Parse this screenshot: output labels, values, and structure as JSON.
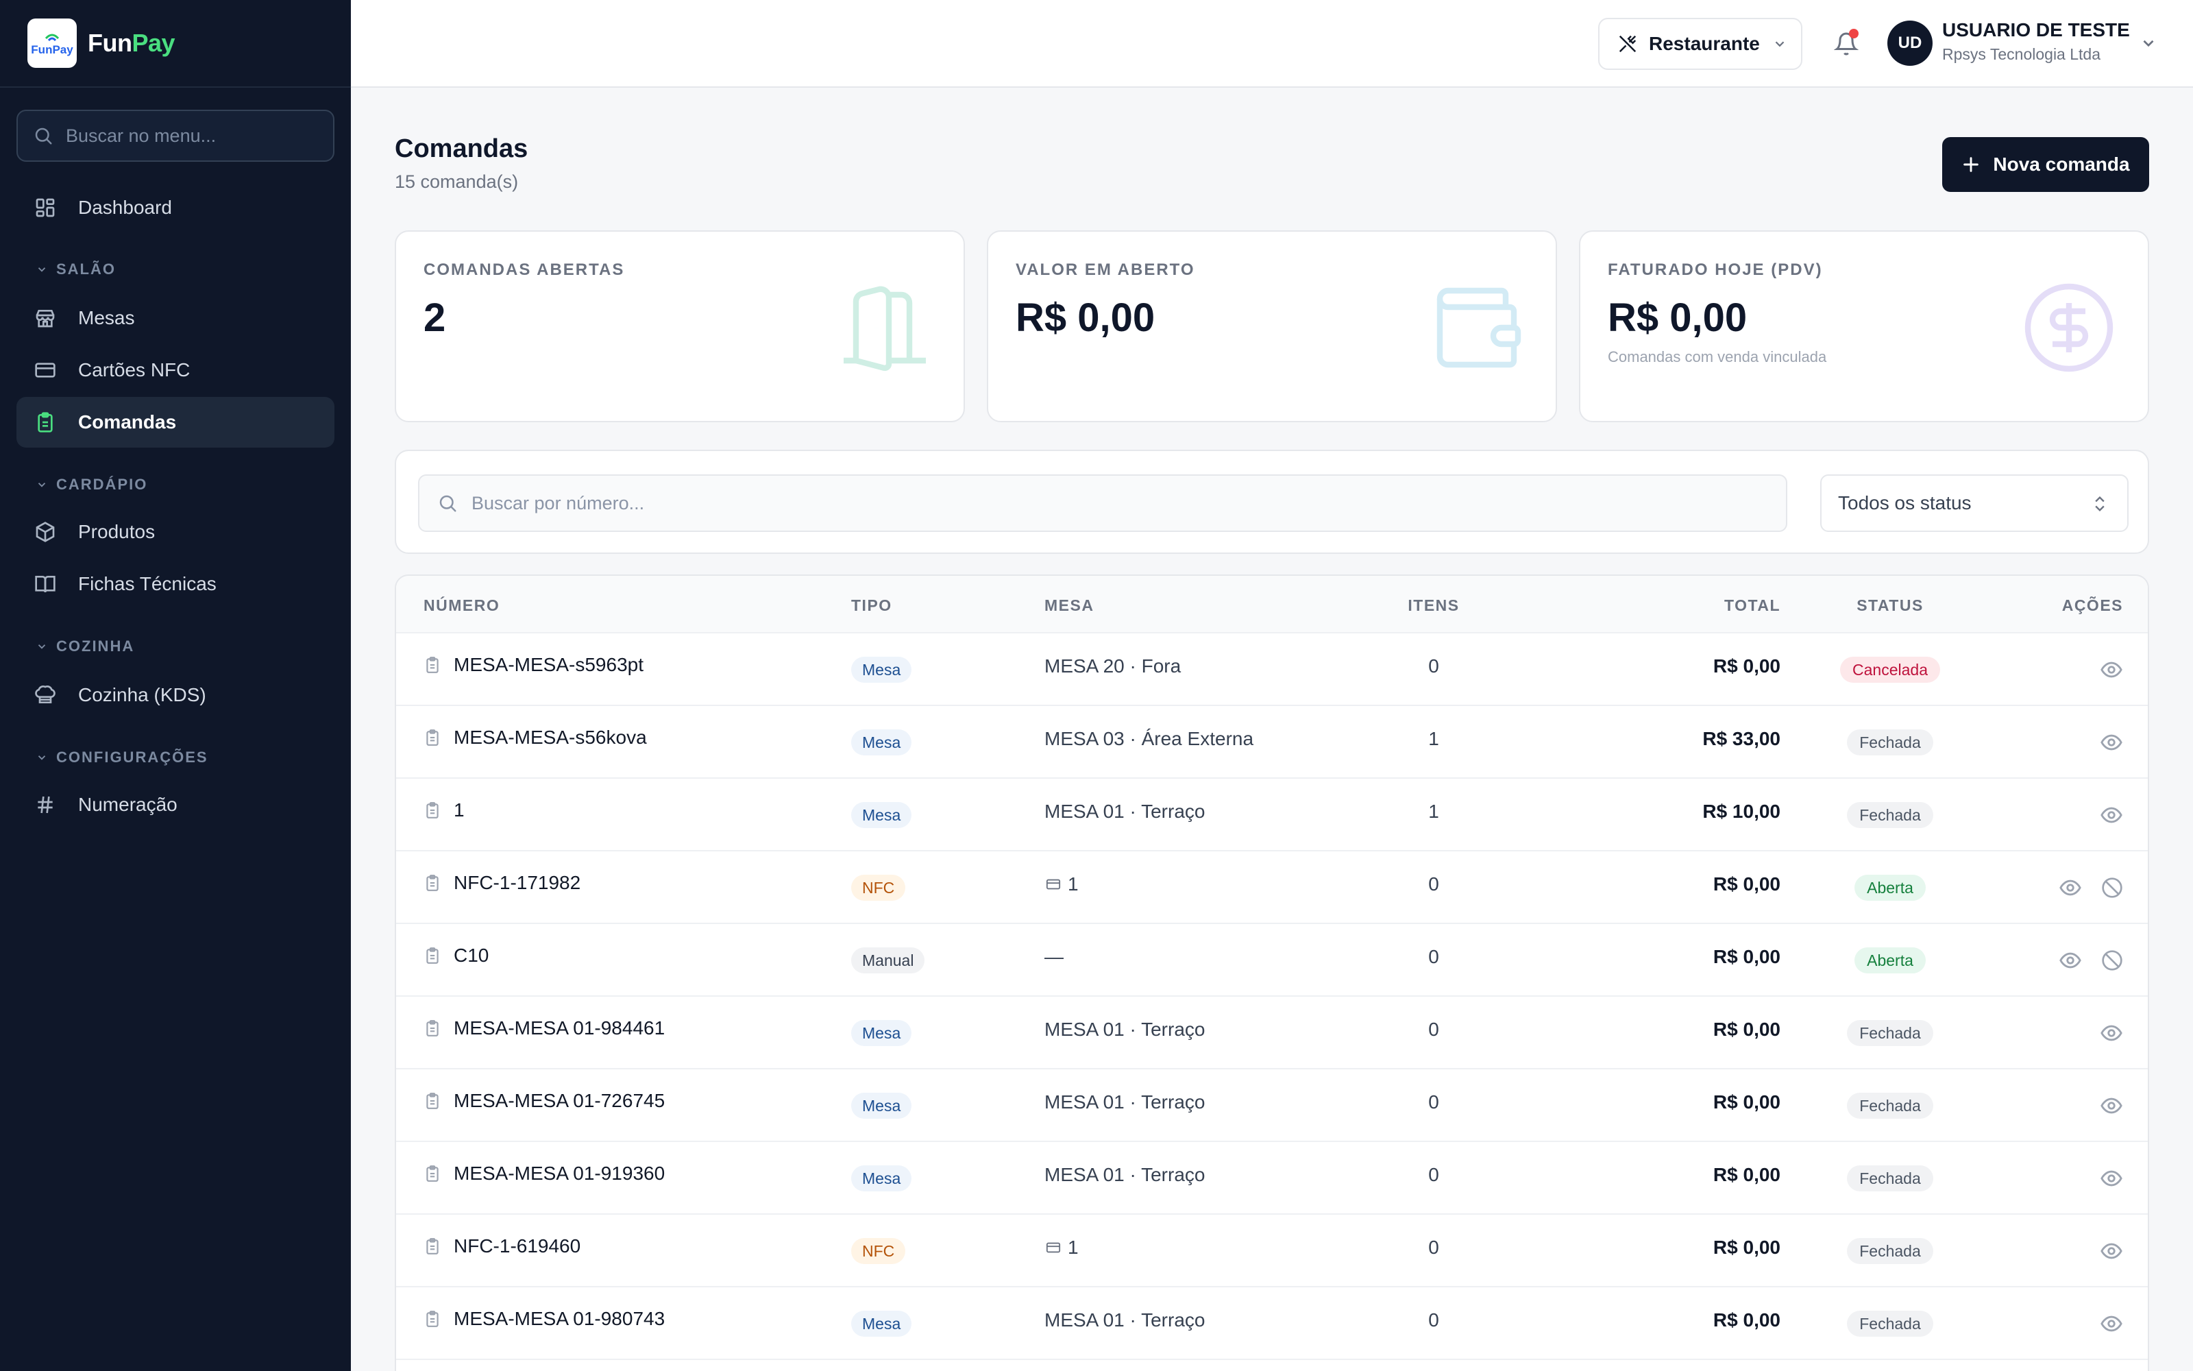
{
  "brand": {
    "logo_text": "FunPay",
    "name_part1": "Fun",
    "name_part2": "Pay"
  },
  "sidebar": {
    "search_placeholder": "Buscar no menu...",
    "dashboard": "Dashboard",
    "sections": {
      "salao": "SALÃO",
      "cardapio": "CARDÁPIO",
      "cozinha": "COZINHA",
      "configuracoes": "CONFIGURAÇÕES"
    },
    "items": {
      "mesas": "Mesas",
      "cartoes": "Cartões NFC",
      "comandas": "Comandas",
      "produtos": "Produtos",
      "fichas": "Fichas Técnicas",
      "kds": "Cozinha (KDS)",
      "numeracao": "Numeração"
    },
    "active": "Comandas"
  },
  "topbar": {
    "restaurant": "Restaurante",
    "avatar_initials": "UD",
    "user_name": "USUARIO DE TESTE",
    "user_company": "Rpsys Tecnologia Ltda",
    "has_notification": true
  },
  "page": {
    "title": "Comandas",
    "subtitle": "15 comanda(s)",
    "new_button": "Nova comanda"
  },
  "stats": {
    "abertas": {
      "label": "COMANDAS ABERTAS",
      "value": "2"
    },
    "valor": {
      "label": "VALOR EM ABERTO",
      "value": "R$ 0,00"
    },
    "faturado": {
      "label": "FATURADO HOJE (PDV)",
      "value": "R$ 0,00",
      "sub": "Comandas com venda vinculada"
    }
  },
  "filters": {
    "search_placeholder": "Buscar por número...",
    "status_selected": "Todos os status"
  },
  "table": {
    "headers": {
      "numero": "NÚMERO",
      "tipo": "TIPO",
      "mesa": "MESA",
      "itens": "ITENS",
      "total": "TOTAL",
      "status": "STATUS",
      "acoes": "AÇÕES"
    },
    "rows": [
      {
        "numero": "MESA-MESA-s5963pt",
        "tipo": "Mesa",
        "mesa": "MESA 20 · Fora",
        "itens": "0",
        "total": "R$ 0,00",
        "status": "Cancelada"
      },
      {
        "numero": "MESA-MESA-s56kova",
        "tipo": "Mesa",
        "mesa": "MESA 03 · Área Externa",
        "itens": "1",
        "total": "R$ 33,00",
        "status": "Fechada"
      },
      {
        "numero": "1",
        "tipo": "Mesa",
        "mesa": "MESA 01 · Terraço",
        "itens": "1",
        "total": "R$ 10,00",
        "status": "Fechada"
      },
      {
        "numero": "NFC-1-171982",
        "tipo": "NFC",
        "mesa": "1",
        "itens": "0",
        "total": "R$ 0,00",
        "status": "Aberta"
      },
      {
        "numero": "C10",
        "tipo": "Manual",
        "mesa": "—",
        "itens": "0",
        "total": "R$ 0,00",
        "status": "Aberta"
      },
      {
        "numero": "MESA-MESA 01-984461",
        "tipo": "Mesa",
        "mesa": "MESA 01 · Terraço",
        "itens": "0",
        "total": "R$ 0,00",
        "status": "Fechada"
      },
      {
        "numero": "MESA-MESA 01-726745",
        "tipo": "Mesa",
        "mesa": "MESA 01 · Terraço",
        "itens": "0",
        "total": "R$ 0,00",
        "status": "Fechada"
      },
      {
        "numero": "MESA-MESA 01-919360",
        "tipo": "Mesa",
        "mesa": "MESA 01 · Terraço",
        "itens": "0",
        "total": "R$ 0,00",
        "status": "Fechada"
      },
      {
        "numero": "NFC-1-619460",
        "tipo": "NFC",
        "mesa": "1",
        "itens": "0",
        "total": "R$ 0,00",
        "status": "Fechada"
      },
      {
        "numero": "MESA-MESA 01-980743",
        "tipo": "Mesa",
        "mesa": "MESA 01 · Terraço",
        "itens": "0",
        "total": "R$ 0,00",
        "status": "Fechada"
      }
    ]
  },
  "colors": {
    "sidebar_bg": "#0f1729",
    "accent_green": "#4ade80",
    "primary_button": "#0f1729",
    "status_cancelada": "#be123c",
    "status_aberta": "#15803d"
  }
}
